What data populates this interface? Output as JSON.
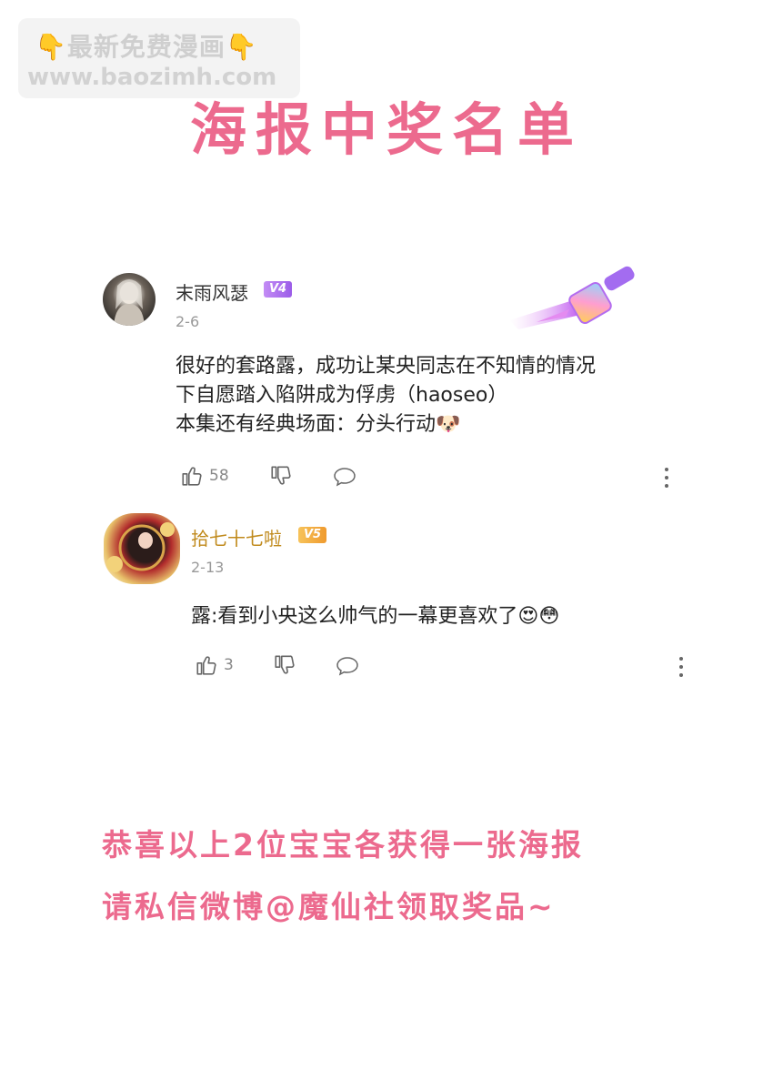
{
  "watermark": {
    "line1": "最新免费漫画",
    "hand_icon": "👇",
    "line2": "www.baozimh.com"
  },
  "title": "海报中奖名单",
  "comments": [
    {
      "username": "末雨风瑟",
      "vip": "V4",
      "date": "2-6",
      "lines": [
        "很好的套路露，成功让某央同志在不知情的情况",
        "下自愿踏入陷阱成为俘虏（haoseo）",
        "本集还有经典场面：分头行动"
      ],
      "emoji": "🐶",
      "likes": "58",
      "decoration_icon": "paintbrush-icon"
    },
    {
      "username": "拾七十七啦",
      "vip": "V5",
      "date": "2-13",
      "lines": [
        "露:看到小央这么帅气的一幕更喜欢了"
      ],
      "emoji": "😍😳",
      "likes": "3"
    }
  ],
  "footer": {
    "line1": "恭喜以上2位宝宝各获得一张海报",
    "line2": "请私信微博@魔仙社领取奖品~"
  },
  "colors": {
    "accent_pink": "#ec6a8e",
    "vip4": "#b06cf0",
    "vip5": "#f2a53a",
    "username_gold": "#c08a1c"
  }
}
